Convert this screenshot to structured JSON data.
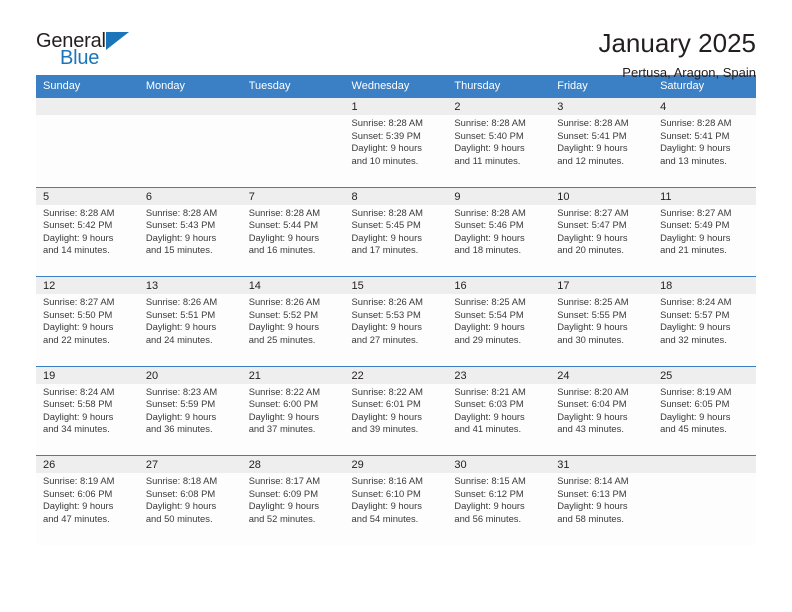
{
  "brand": {
    "name_part1": "General",
    "name_part2": "Blue",
    "logo_icon": "triangle-flag-icon",
    "accent_color": "#1b75bb"
  },
  "header": {
    "title": "January 2025",
    "location": "Pertusa, Aragon, Spain"
  },
  "colors": {
    "header_row_bg": "#3b7fc4",
    "daynum_bg": "#eeeeee",
    "text": "#231f20"
  },
  "calendar": {
    "weekday_headers": [
      "Sunday",
      "Monday",
      "Tuesday",
      "Wednesday",
      "Thursday",
      "Friday",
      "Saturday"
    ],
    "weeks": [
      [
        {
          "day": "",
          "lines": []
        },
        {
          "day": "",
          "lines": []
        },
        {
          "day": "",
          "lines": []
        },
        {
          "day": "1",
          "lines": [
            "Sunrise: 8:28 AM",
            "Sunset: 5:39 PM",
            "Daylight: 9 hours",
            "and 10 minutes."
          ]
        },
        {
          "day": "2",
          "lines": [
            "Sunrise: 8:28 AM",
            "Sunset: 5:40 PM",
            "Daylight: 9 hours",
            "and 11 minutes."
          ]
        },
        {
          "day": "3",
          "lines": [
            "Sunrise: 8:28 AM",
            "Sunset: 5:41 PM",
            "Daylight: 9 hours",
            "and 12 minutes."
          ]
        },
        {
          "day": "4",
          "lines": [
            "Sunrise: 8:28 AM",
            "Sunset: 5:41 PM",
            "Daylight: 9 hours",
            "and 13 minutes."
          ]
        }
      ],
      [
        {
          "day": "5",
          "lines": [
            "Sunrise: 8:28 AM",
            "Sunset: 5:42 PM",
            "Daylight: 9 hours",
            "and 14 minutes."
          ]
        },
        {
          "day": "6",
          "lines": [
            "Sunrise: 8:28 AM",
            "Sunset: 5:43 PM",
            "Daylight: 9 hours",
            "and 15 minutes."
          ]
        },
        {
          "day": "7",
          "lines": [
            "Sunrise: 8:28 AM",
            "Sunset: 5:44 PM",
            "Daylight: 9 hours",
            "and 16 minutes."
          ]
        },
        {
          "day": "8",
          "lines": [
            "Sunrise: 8:28 AM",
            "Sunset: 5:45 PM",
            "Daylight: 9 hours",
            "and 17 minutes."
          ]
        },
        {
          "day": "9",
          "lines": [
            "Sunrise: 8:28 AM",
            "Sunset: 5:46 PM",
            "Daylight: 9 hours",
            "and 18 minutes."
          ]
        },
        {
          "day": "10",
          "lines": [
            "Sunrise: 8:27 AM",
            "Sunset: 5:47 PM",
            "Daylight: 9 hours",
            "and 20 minutes."
          ]
        },
        {
          "day": "11",
          "lines": [
            "Sunrise: 8:27 AM",
            "Sunset: 5:49 PM",
            "Daylight: 9 hours",
            "and 21 minutes."
          ]
        }
      ],
      [
        {
          "day": "12",
          "lines": [
            "Sunrise: 8:27 AM",
            "Sunset: 5:50 PM",
            "Daylight: 9 hours",
            "and 22 minutes."
          ]
        },
        {
          "day": "13",
          "lines": [
            "Sunrise: 8:26 AM",
            "Sunset: 5:51 PM",
            "Daylight: 9 hours",
            "and 24 minutes."
          ]
        },
        {
          "day": "14",
          "lines": [
            "Sunrise: 8:26 AM",
            "Sunset: 5:52 PM",
            "Daylight: 9 hours",
            "and 25 minutes."
          ]
        },
        {
          "day": "15",
          "lines": [
            "Sunrise: 8:26 AM",
            "Sunset: 5:53 PM",
            "Daylight: 9 hours",
            "and 27 minutes."
          ]
        },
        {
          "day": "16",
          "lines": [
            "Sunrise: 8:25 AM",
            "Sunset: 5:54 PM",
            "Daylight: 9 hours",
            "and 29 minutes."
          ]
        },
        {
          "day": "17",
          "lines": [
            "Sunrise: 8:25 AM",
            "Sunset: 5:55 PM",
            "Daylight: 9 hours",
            "and 30 minutes."
          ]
        },
        {
          "day": "18",
          "lines": [
            "Sunrise: 8:24 AM",
            "Sunset: 5:57 PM",
            "Daylight: 9 hours",
            "and 32 minutes."
          ]
        }
      ],
      [
        {
          "day": "19",
          "lines": [
            "Sunrise: 8:24 AM",
            "Sunset: 5:58 PM",
            "Daylight: 9 hours",
            "and 34 minutes."
          ]
        },
        {
          "day": "20",
          "lines": [
            "Sunrise: 8:23 AM",
            "Sunset: 5:59 PM",
            "Daylight: 9 hours",
            "and 36 minutes."
          ]
        },
        {
          "day": "21",
          "lines": [
            "Sunrise: 8:22 AM",
            "Sunset: 6:00 PM",
            "Daylight: 9 hours",
            "and 37 minutes."
          ]
        },
        {
          "day": "22",
          "lines": [
            "Sunrise: 8:22 AM",
            "Sunset: 6:01 PM",
            "Daylight: 9 hours",
            "and 39 minutes."
          ]
        },
        {
          "day": "23",
          "lines": [
            "Sunrise: 8:21 AM",
            "Sunset: 6:03 PM",
            "Daylight: 9 hours",
            "and 41 minutes."
          ]
        },
        {
          "day": "24",
          "lines": [
            "Sunrise: 8:20 AM",
            "Sunset: 6:04 PM",
            "Daylight: 9 hours",
            "and 43 minutes."
          ]
        },
        {
          "day": "25",
          "lines": [
            "Sunrise: 8:19 AM",
            "Sunset: 6:05 PM",
            "Daylight: 9 hours",
            "and 45 minutes."
          ]
        }
      ],
      [
        {
          "day": "26",
          "lines": [
            "Sunrise: 8:19 AM",
            "Sunset: 6:06 PM",
            "Daylight: 9 hours",
            "and 47 minutes."
          ]
        },
        {
          "day": "27",
          "lines": [
            "Sunrise: 8:18 AM",
            "Sunset: 6:08 PM",
            "Daylight: 9 hours",
            "and 50 minutes."
          ]
        },
        {
          "day": "28",
          "lines": [
            "Sunrise: 8:17 AM",
            "Sunset: 6:09 PM",
            "Daylight: 9 hours",
            "and 52 minutes."
          ]
        },
        {
          "day": "29",
          "lines": [
            "Sunrise: 8:16 AM",
            "Sunset: 6:10 PM",
            "Daylight: 9 hours",
            "and 54 minutes."
          ]
        },
        {
          "day": "30",
          "lines": [
            "Sunrise: 8:15 AM",
            "Sunset: 6:12 PM",
            "Daylight: 9 hours",
            "and 56 minutes."
          ]
        },
        {
          "day": "31",
          "lines": [
            "Sunrise: 8:14 AM",
            "Sunset: 6:13 PM",
            "Daylight: 9 hours",
            "and 58 minutes."
          ]
        },
        {
          "day": "",
          "lines": []
        }
      ]
    ]
  }
}
